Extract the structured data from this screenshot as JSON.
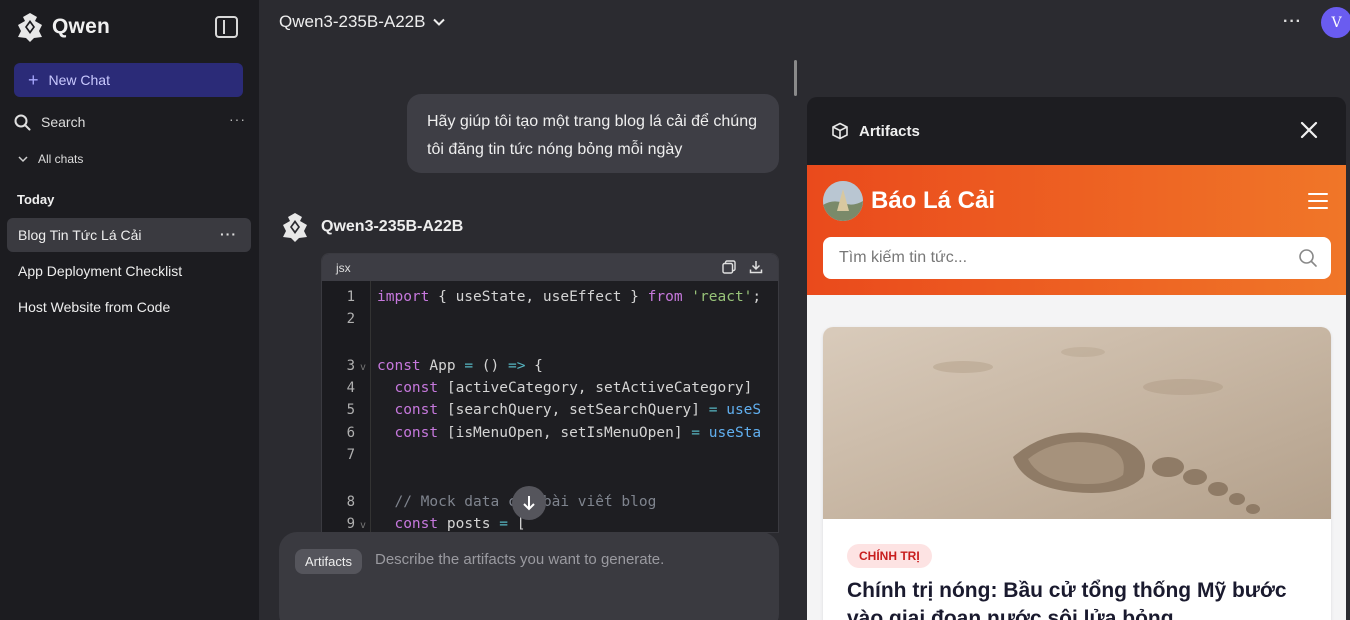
{
  "sidebar": {
    "brand": "Qwen",
    "new_chat": "New Chat",
    "search_label": "Search",
    "all_chats": "All chats",
    "section_today": "Today",
    "chats": [
      {
        "title": "Blog Tin Tức Lá Cải",
        "active": true
      },
      {
        "title": "App Deployment Checklist",
        "active": false
      },
      {
        "title": "Host Website from Code",
        "active": false
      }
    ]
  },
  "topbar": {
    "model": "Qwen3-235B-A22B",
    "avatar_initial": "V"
  },
  "conversation": {
    "user_message": "Hãy giúp tôi tạo một trang blog lá cải để chúng tôi đăng tin tức nóng bỏng mỗi ngày",
    "assistant_name": "Qwen3-235B-A22B",
    "code": {
      "language": "jsx",
      "line_numbers": [
        "1",
        "2",
        "3",
        "4",
        "5",
        "6",
        "7",
        "8",
        "9"
      ],
      "lines": [
        "import { useState, useEffect } from 'react';",
        "",
        "const App = () => {",
        "  const [activeCategory, setActiveCategory]",
        "  const [searchQuery, setSearchQuery] = useS",
        "  const [isMenuOpen, setIsMenuOpen] = useSta",
        "",
        "  // Mock data cho bài viết blog",
        "  const posts = ["
      ]
    }
  },
  "composer": {
    "chip": "Artifacts",
    "placeholder": "Describe the artifacts you want to generate."
  },
  "artifacts": {
    "title": "Artifacts",
    "preview": {
      "site_title": "Báo Lá Cải",
      "search_placeholder": "Tìm kiếm tin tức...",
      "article_category": "CHÍNH TRỊ",
      "article_title": "Chính trị nóng: Bầu cử tổng thống Mỹ bước vào giai đoạn nước sôi lửa bỏng"
    }
  },
  "colors": {
    "sidebar_bg": "#1c1c20",
    "main_bg": "#2b2b30",
    "new_chat_bg": "#2b2b78",
    "avatar": "#6a5cf0",
    "site_header_start": "#ea4a1c",
    "site_header_end": "#f07628",
    "badge_text": "#c81e1e"
  },
  "icons": [
    "qwen-logo-icon",
    "sidebar-toggle-icon",
    "plus-icon",
    "search-icon",
    "more-icon",
    "chevron-down-icon",
    "copy-icon",
    "download-icon",
    "arrow-down-icon",
    "cube-icon",
    "close-icon",
    "hamburger-icon"
  ]
}
